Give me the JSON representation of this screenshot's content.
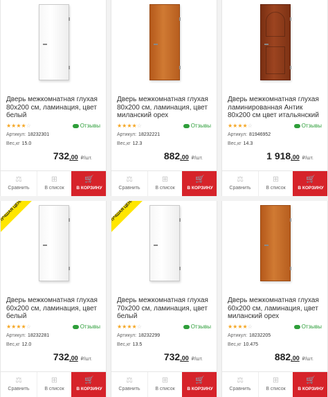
{
  "accent_color": "#d6232a",
  "rating_color": "#f5a623",
  "reviews_color": "#2e9e3a",
  "labels": {
    "reviews": "Отзывы",
    "article": "Артикул:",
    "weight": "Вес,кг",
    "compare": "Сравнить",
    "to_list": "В список",
    "to_cart": "В КОРЗИНУ",
    "unit": "₽/шт.",
    "badge": "ЛУЧШАЯ ЦЕНА"
  },
  "icons": {
    "compare": "scales-icon",
    "list": "plus-icon",
    "cart": "cart-icon",
    "reviews": "chat-icon"
  },
  "products": [
    {
      "title": "Дверь межкомнатная глухая 80x200 см, ламинация, цвет белый",
      "article": "18232301",
      "weight": "15.0",
      "price_main": "732",
      "price_cents": ",00",
      "rating": 4,
      "finish": "white"
    },
    {
      "title": "Дверь межкомнатная глухая 80x200 см, ламинация, цвет миланский орех",
      "article": "18232221",
      "weight": "12.3",
      "price_main": "882",
      "price_cents": ",00",
      "rating": 4,
      "finish": "milan"
    },
    {
      "title": "Дверь межкомнатная глухая ламинированная Антик 80x200 см цвет итальянский орех",
      "article": "81946952",
      "weight": "14.3",
      "price_main": "1 918",
      "price_cents": ",00",
      "rating": 4,
      "finish": "italian"
    },
    {
      "title": "Дверь межкомнатная глухая 60x200 см, ламинация, цвет белый",
      "article": "18232281",
      "weight": "12.0",
      "price_main": "732",
      "price_cents": ",00",
      "rating": 3.5,
      "finish": "white",
      "badge": true
    },
    {
      "title": "Дверь межкомнатная глухая 70x200 см, ламинация, цвет белый",
      "article": "18232299",
      "weight": "13.5",
      "price_main": "732",
      "price_cents": ",00",
      "rating": 3.5,
      "finish": "white",
      "badge": true
    },
    {
      "title": "Дверь межкомнатная глухая 60x200 см, ламинация, цвет миланский орех",
      "article": "18232205",
      "weight": "10.475",
      "price_main": "882",
      "price_cents": ",00",
      "rating": 4,
      "finish": "milan"
    }
  ]
}
